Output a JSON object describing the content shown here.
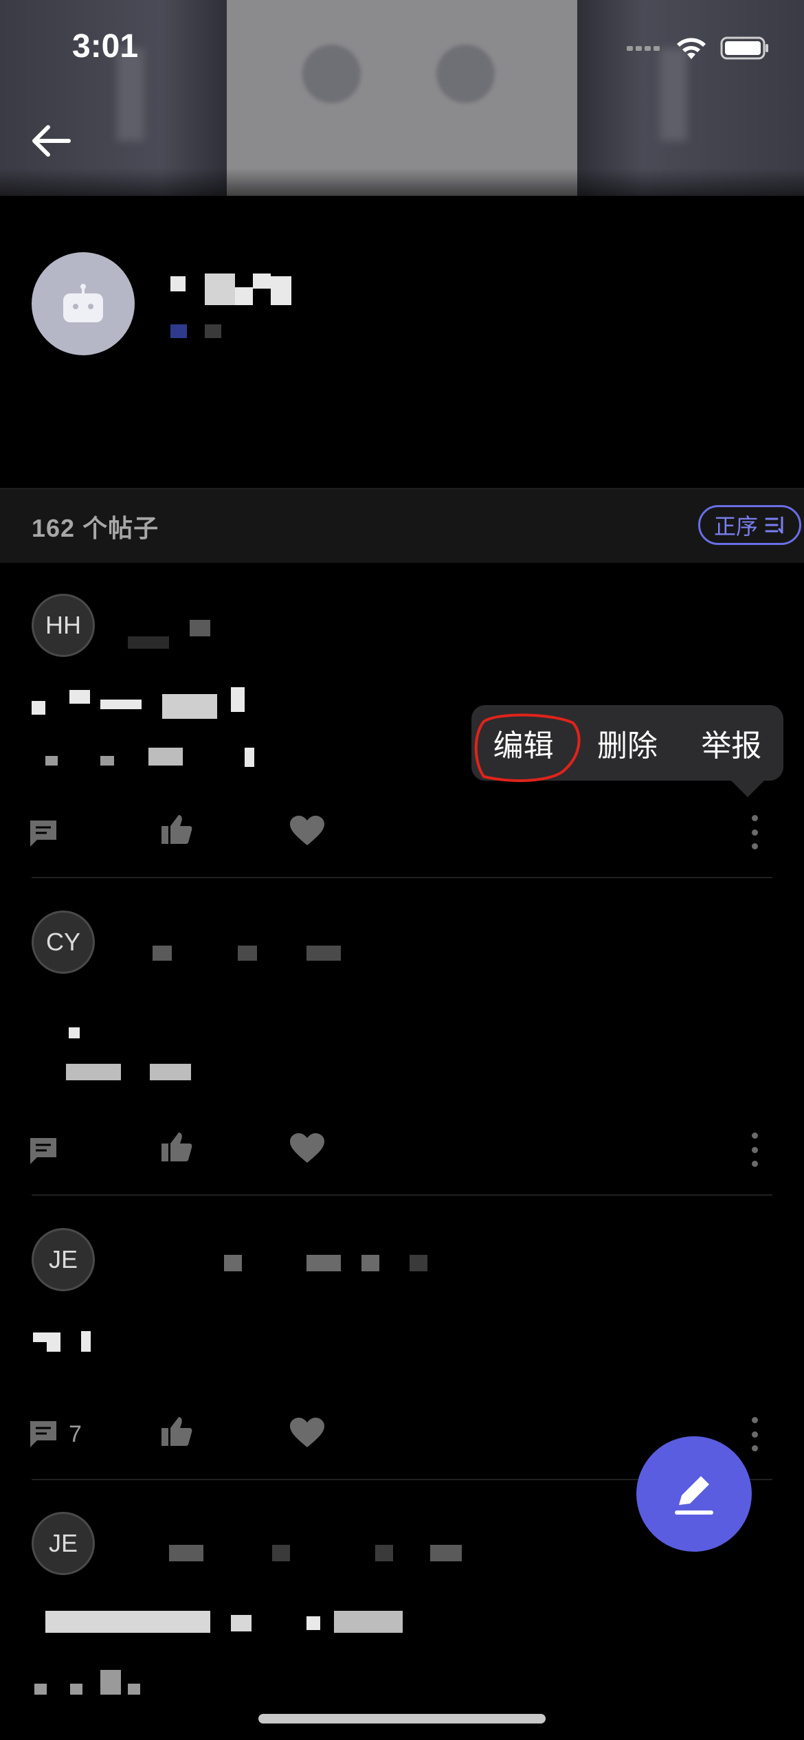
{
  "status_bar": {
    "time": "3:01"
  },
  "header": {
    "back_label": "←"
  },
  "profile": {
    "avatar_icon": "robot-icon"
  },
  "list": {
    "count_label": "162 个帖子",
    "sort_label": "正序",
    "sort_icon": "sort-icon"
  },
  "posts": [
    {
      "initials": "HH",
      "comment_count": ""
    },
    {
      "initials": "CY",
      "comment_count": ""
    },
    {
      "initials": "JE",
      "comment_count": "7"
    },
    {
      "initials": "JE",
      "comment_count": ""
    }
  ],
  "context_menu": {
    "items": [
      "编辑",
      "删除",
      "举报"
    ]
  },
  "fab": {
    "icon": "pencil-icon"
  },
  "colors": {
    "accent": "#5a5de0",
    "menu_bg": "#2c2c2e",
    "annotation": "#e0231b"
  }
}
